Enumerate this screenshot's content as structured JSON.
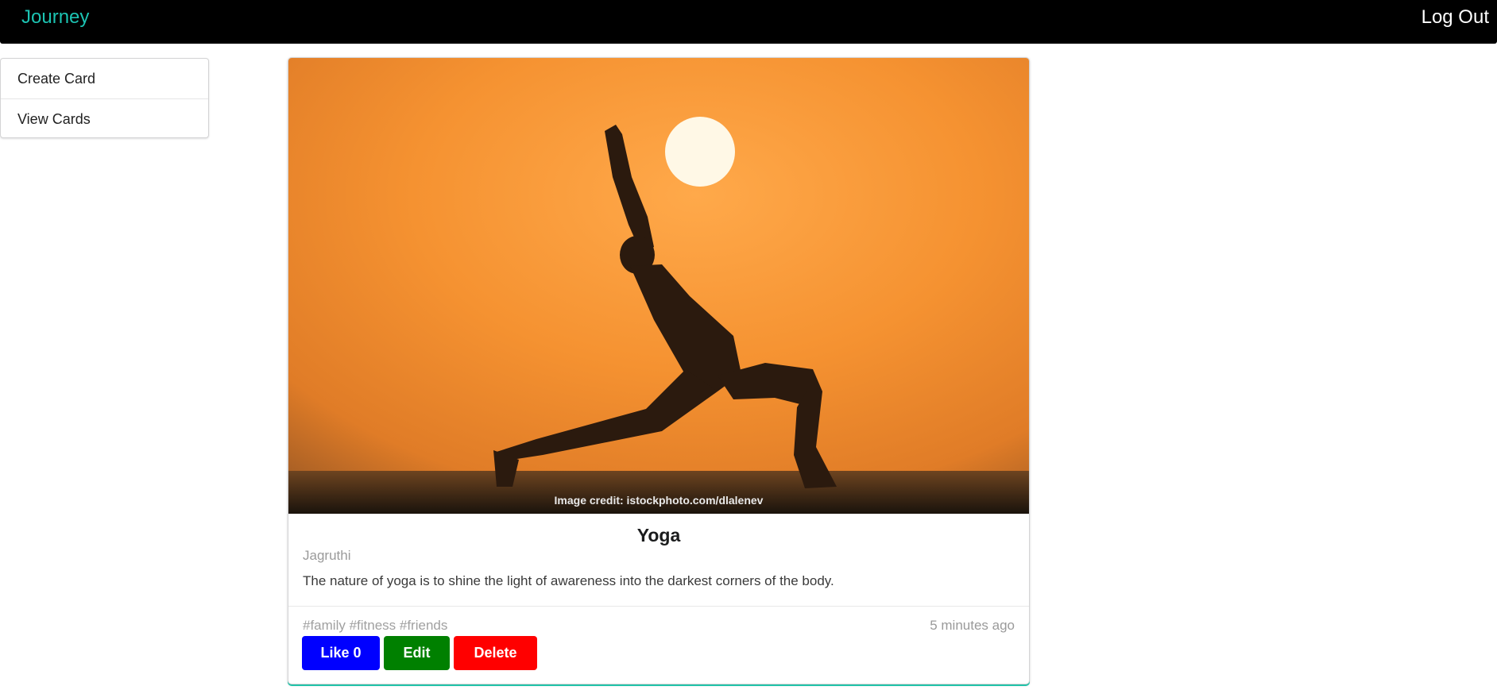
{
  "header": {
    "brand": "Journey",
    "logout_label": "Log Out"
  },
  "sidebar": {
    "items": [
      {
        "label": "Create Card"
      },
      {
        "label": "View Cards"
      }
    ]
  },
  "card": {
    "image_caption": "Image credit: istockphoto.com/dlalenev",
    "title": "Yoga",
    "author": "Jagruthi",
    "description": "The nature of yoga is to shine the light of awareness into the darkest corners of the body.",
    "tags": "#family #fitness #friends",
    "time": "5 minutes ago",
    "like_label": "Like 0",
    "edit_label": "Edit",
    "delete_label": "Delete"
  },
  "colors": {
    "brand": "#1cc3b2",
    "like": "#0000ff",
    "edit": "#008000",
    "delete": "#ff0000",
    "card_accent": "#21c2a8"
  }
}
